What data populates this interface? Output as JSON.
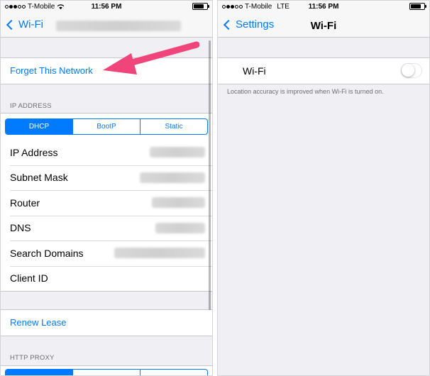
{
  "left_screen": {
    "status": {
      "carrier": "T-Mobile",
      "time": "11:56 PM"
    },
    "nav": {
      "back_label": "Wi-Fi"
    },
    "forget_label": "Forget This Network",
    "ip_section_header": "IP ADDRESS",
    "ip_segments": [
      "DHCP",
      "BootP",
      "Static"
    ],
    "ip_selected": "DHCP",
    "ip_rows": [
      {
        "label": "IP Address"
      },
      {
        "label": "Subnet Mask"
      },
      {
        "label": "Router"
      },
      {
        "label": "DNS"
      },
      {
        "label": "Search Domains"
      },
      {
        "label": "Client ID"
      }
    ],
    "renew_label": "Renew Lease",
    "proxy_section_header": "HTTP PROXY"
  },
  "right_screen": {
    "status": {
      "carrier": "T-Mobile",
      "network": "LTE",
      "time": "11:56 PM"
    },
    "nav": {
      "back_label": "Settings",
      "title": "Wi-Fi"
    },
    "wifi_label": "Wi-Fi",
    "wifi_on": false,
    "footer": "Location accuracy is improved when Wi-Fi is turned on."
  },
  "colors": {
    "accent": "#007aff",
    "annotation_arrow": "#f0457a",
    "background": "#efeff4"
  },
  "icons": [
    "wifi-icon",
    "battery-icon",
    "back-chevron-icon",
    "arrow-annotation"
  ]
}
